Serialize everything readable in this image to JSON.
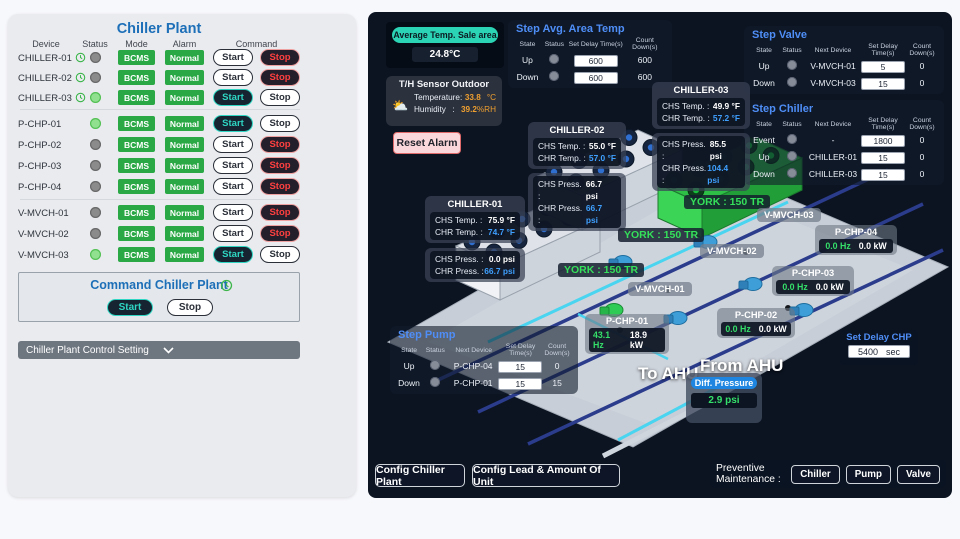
{
  "left_panel": {
    "title": "Chiller Plant",
    "columns": [
      "Device",
      "Status",
      "Mode",
      "Alarm",
      "Command"
    ],
    "start_label": "Start",
    "stop_label": "Stop",
    "rows": [
      {
        "device": "CHILLER-01",
        "clock": true,
        "status": "off",
        "mode": "BCMS",
        "alarm": "Normal",
        "active": "stop"
      },
      {
        "device": "CHILLER-02",
        "clock": true,
        "status": "off",
        "mode": "BCMS",
        "alarm": "Normal",
        "active": "stop"
      },
      {
        "device": "CHILLER-03",
        "clock": true,
        "status": "on",
        "mode": "BCMS",
        "alarm": "Normal",
        "active": "start"
      },
      {
        "device": "P-CHP-01",
        "clock": false,
        "status": "on",
        "mode": "BCMS",
        "alarm": "Normal",
        "active": "start"
      },
      {
        "device": "P-CHP-02",
        "clock": false,
        "status": "off",
        "mode": "BCMS",
        "alarm": "Normal",
        "active": "stop"
      },
      {
        "device": "P-CHP-03",
        "clock": false,
        "status": "off",
        "mode": "BCMS",
        "alarm": "Normal",
        "active": "stop"
      },
      {
        "device": "P-CHP-04",
        "clock": false,
        "status": "off",
        "mode": "BCMS",
        "alarm": "Normal",
        "active": "stop"
      },
      {
        "device": "V-MVCH-01",
        "clock": false,
        "status": "off",
        "mode": "BCMS",
        "alarm": "Normal",
        "active": "stop"
      },
      {
        "device": "V-MVCH-02",
        "clock": false,
        "status": "off",
        "mode": "BCMS",
        "alarm": "Normal",
        "active": "stop"
      },
      {
        "device": "V-MVCH-03",
        "clock": false,
        "status": "on",
        "mode": "BCMS",
        "alarm": "Normal",
        "active": "start"
      }
    ],
    "command_box": {
      "title": "Command Chiller Plant",
      "start": "Start",
      "stop": "Stop"
    },
    "control_setting": "Chiller Plant Control Setting"
  },
  "plant": {
    "avg_temp": {
      "label": "Average Temp. Sale area",
      "value": "24.8°C"
    },
    "th_sensor": {
      "title": "T/H Sensor Outdoor",
      "temp_label": "Temperature",
      "colon": ":",
      "temp_value": "33.8",
      "temp_unit": "°C",
      "hum_label": "Humidity",
      "hum_value": "39.2",
      "hum_unit": "%RH"
    },
    "reset_alarm": "Reset Alarm",
    "labels": {
      "chs_temp": "CHS Temp. :",
      "chr_temp": "CHR Temp. :",
      "chs_press": "CHS Press. :",
      "chr_press": "CHR Press. :"
    },
    "step_avg": {
      "title": "Step Avg. Area Temp",
      "columns": [
        "State",
        "Status",
        "Set Delay Time(s)",
        "Count Down(s)"
      ],
      "rows": [
        {
          "state": "Up",
          "delay": "600",
          "count": "600"
        },
        {
          "state": "Down",
          "delay": "600",
          "count": "600"
        }
      ]
    },
    "step_valve": {
      "title": "Step Valve",
      "columns": [
        "State",
        "Status",
        "Next Device",
        "Set Delay Time(s)",
        "Count Down(s)"
      ],
      "rows": [
        {
          "state": "Up",
          "next": "V-MVCH-01",
          "delay": "5",
          "count": "0"
        },
        {
          "state": "Down",
          "next": "V-MVCH-03",
          "delay": "15",
          "count": "0"
        }
      ]
    },
    "step_chiller": {
      "title": "Step Chiller",
      "columns": [
        "State",
        "Status",
        "Next Device",
        "Set Delay Time(s)",
        "Count Down(s)"
      ],
      "rows": [
        {
          "state": "Event",
          "next": "-",
          "delay": "1800",
          "count": "0"
        },
        {
          "state": "Up",
          "next": "CHILLER-01",
          "delay": "15",
          "count": "0"
        },
        {
          "state": "Down",
          "next": "CHILLER-03",
          "delay": "15",
          "count": "0"
        }
      ]
    },
    "step_pump": {
      "title": "Step Pump",
      "columns": [
        "State",
        "Status",
        "Next Device",
        "Set Delay Time(s)",
        "Count Down(s)"
      ],
      "rows": [
        {
          "state": "Up",
          "next": "P-CHP-04",
          "delay": "15",
          "count": "0"
        },
        {
          "state": "Down",
          "next": "P-CHP-01",
          "delay": "15",
          "count": "15"
        }
      ]
    },
    "chillers": [
      {
        "name": "CHILLER-01",
        "chs_temp": "75.9 °F",
        "chr_temp": "74.7 °F",
        "chs_press": "0.0 psi",
        "chr_press": "66.7 psi"
      },
      {
        "name": "CHILLER-02",
        "chs_temp": "55.0 °F",
        "chr_temp": "57.0 °F",
        "chs_press": "66.7 psi",
        "chr_press": "66.7 psi"
      },
      {
        "name": "CHILLER-03",
        "chs_temp": "49.9 °F",
        "chr_temp": "57.2 °F",
        "chs_press": "85.5 psi",
        "chr_press": "104.4 psi"
      }
    ],
    "york_label": "YORK : 150 TR",
    "valve_labels": [
      "V-MVCH-01",
      "V-MVCH-02",
      "V-MVCH-03"
    ],
    "pumps": [
      {
        "name": "P-CHP-01",
        "hz": "43.1 Hz",
        "kw": "18.9 kW"
      },
      {
        "name": "P-CHP-02",
        "hz": "0.0 Hz",
        "kw": "0.0 kW"
      },
      {
        "name": "P-CHP-03",
        "hz": "0.0 Hz",
        "kw": "0.0 kW"
      },
      {
        "name": "P-CHP-04",
        "hz": "0.0 Hz",
        "kw": "0.0 kW"
      }
    ],
    "to_ahu": "To AHU",
    "from_ahu": "From AHU",
    "diff_pressure": {
      "label": "Diff. Pressure",
      "value": "2.9 psi"
    },
    "set_delay_chp": {
      "title": "Set Delay CHP",
      "value": "5400",
      "unit": "sec"
    },
    "footer": {
      "config_chiller": "Config Chiller Plant",
      "config_lead": "Config Lead & Amount Of Unit",
      "pm_label": "Preventive Maintenance :",
      "pm_buttons": [
        "Chiller",
        "Pump",
        "Valve"
      ]
    }
  },
  "colors": {
    "accent_green": "#2aa845",
    "accent_teal": "#2fd6c3",
    "alarm_red": "#ff4040",
    "title_blue": "#1d6fb8",
    "step_blue": "#4f8ef7"
  }
}
